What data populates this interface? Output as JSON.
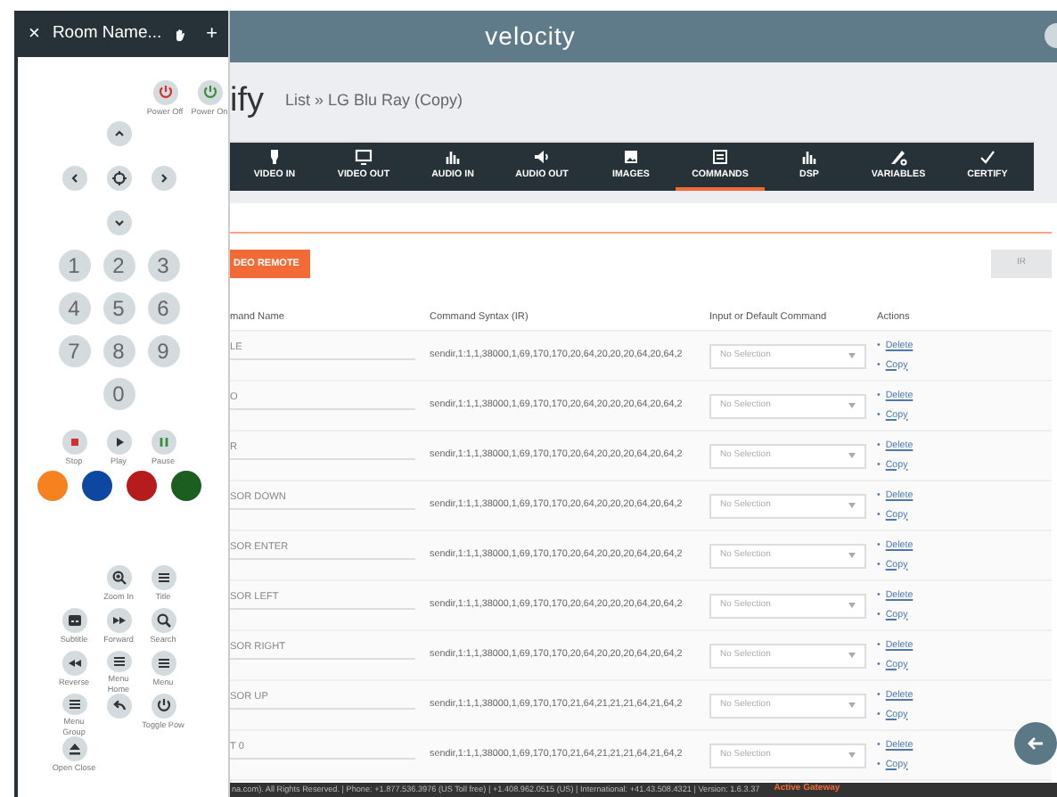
{
  "header": {
    "logo": "velocity"
  },
  "page": {
    "title": "ify",
    "breadcrumb": "List » LG Blu Ray (Copy)"
  },
  "tabs": [
    {
      "label": "VIDEO IN",
      "selected": false
    },
    {
      "label": "VIDEO OUT",
      "selected": false
    },
    {
      "label": "AUDIO IN",
      "selected": false
    },
    {
      "label": "AUDIO OUT",
      "selected": false
    },
    {
      "label": "IMAGES",
      "selected": false
    },
    {
      "label": "COMMANDS",
      "selected": true
    },
    {
      "label": "DSP",
      "selected": false
    },
    {
      "label": "VARIABLES",
      "selected": false
    },
    {
      "label": "CERTIFY",
      "selected": false
    }
  ],
  "toolbar": {
    "primary_button": "DEO REMOTE",
    "type_button": "IR"
  },
  "table": {
    "columns": [
      "mand Name",
      "Command Syntax (IR)",
      "Input or Default Command",
      "Actions"
    ],
    "rows": [
      {
        "name": "LE",
        "syntax": "sendir,1:1,1,38000,1,69,170,170,20,64,20,20,20,64,20,64,2",
        "select": "No Selection",
        "actions": [
          {
            "marker": "•",
            "text": "Delete"
          },
          {
            "marker": "•",
            "text": "Copy"
          }
        ]
      },
      {
        "name": "O",
        "syntax": "sendir,1:1,1,38000,1,69,170,170,20,64,20,20,20,64,20,64,2",
        "select": "No Selection",
        "actions": [
          {
            "marker": "•",
            "text": "Delete"
          },
          {
            "marker": "•",
            "text": "Copy"
          }
        ]
      },
      {
        "name": "R",
        "syntax": "sendir,1:1,1,38000,1,69,170,170,20,64,20,20,20,64,20,64,2",
        "select": "No Selection",
        "actions": [
          {
            "marker": "•",
            "text": "Delete"
          },
          {
            "marker": "•",
            "text": "Copy"
          }
        ]
      },
      {
        "name": "SOR DOWN",
        "syntax": "sendir,1:1,1,38000,1,69,170,170,20,64,20,20,20,64,20,64,2",
        "select": "No Selection",
        "actions": [
          {
            "marker": "•",
            "text": "Delete"
          },
          {
            "marker": "•",
            "text": "Copy"
          }
        ]
      },
      {
        "name": "SOR ENTER",
        "syntax": "sendir,1:1,1,38000,1,69,170,170,20,64,20,20,20,64,20,64,2",
        "select": "No Selection",
        "actions": [
          {
            "marker": "•",
            "text": "Delete"
          },
          {
            "marker": "•",
            "text": "Copy"
          }
        ]
      },
      {
        "name": "SOR LEFT",
        "syntax": "sendir,1:1,1,38000,1,69,170,170,20,64,20,20,20,64,20,64,2",
        "select": "No Selection",
        "actions": [
          {
            "marker": "•",
            "text": "Delete"
          },
          {
            "marker": "•",
            "text": "Copy"
          }
        ]
      },
      {
        "name": "SOR RIGHT",
        "syntax": "sendir,1:1,1,38000,1,69,170,170,20,64,20,20,20,64,20,64,2",
        "select": "No Selection",
        "actions": [
          {
            "marker": "•",
            "text": "Delete"
          },
          {
            "marker": "•",
            "text": "Copy"
          }
        ]
      },
      {
        "name": "SOR UP",
        "syntax": "sendir,1:1,1,38000,1,69,170,170,21,64,21,21,21,64,21,64,2",
        "select": "No Selection",
        "actions": [
          {
            "marker": "•",
            "text": "Delete"
          },
          {
            "marker": "•",
            "text": "Copy"
          }
        ]
      },
      {
        "name": "T 0",
        "syntax": "sendir,1:1,1,38000,1,69,170,170,21,64,21,21,21,64,21,64,2",
        "select": "No Selection",
        "actions": [
          {
            "marker": "•",
            "text": "Delete"
          },
          {
            "marker": "•",
            "text": "Copy"
          }
        ]
      }
    ]
  },
  "footer": {
    "text": "na.com). All Rights Reserved. | Phone: +1.877.536.3976 (US Toll free) | +1.408.962.0515 (US) | International: +41.43.508.4321 | Version: 1.6.3.37",
    "status": "Active Gateway"
  },
  "remote": {
    "close": "×",
    "title": "Room Name...",
    "add": "+",
    "power_buttons": [
      {
        "label": "Power Off"
      },
      {
        "label": "Power On"
      }
    ],
    "keypad": [
      "1",
      "2",
      "3",
      "4",
      "5",
      "6",
      "7",
      "8",
      "9",
      "0"
    ],
    "transport": [
      {
        "label": "Stop"
      },
      {
        "label": "Play"
      },
      {
        "label": "Pause"
      }
    ],
    "color_buttons": [
      {
        "color": "#f5821f"
      },
      {
        "color": "#0d47a1"
      },
      {
        "color": "#b71c1c"
      },
      {
        "color": "#1b5e20"
      }
    ],
    "function_buttons": [
      {
        "kind": "labeled",
        "label": "Zoom In"
      },
      {
        "kind": "labeled",
        "label": "Title"
      },
      {
        "kind": "labeled",
        "label": "Subtitle"
      },
      {
        "kind": "labeled",
        "label": "Forward"
      },
      {
        "kind": "labeled",
        "label": "Search"
      },
      {
        "kind": "labeled",
        "label": "Reverse"
      },
      {
        "kind": "labeled",
        "label": "Menu Home"
      },
      {
        "kind": "labeled",
        "label": "Menu"
      },
      {
        "kind": "labeled",
        "label": "Menu Group"
      },
      {
        "kind": "icon_only"
      },
      {
        "kind": "labeled",
        "label": "Toggle Pow"
      },
      {
        "kind": "labeled",
        "label": "Open Close"
      }
    ]
  }
}
